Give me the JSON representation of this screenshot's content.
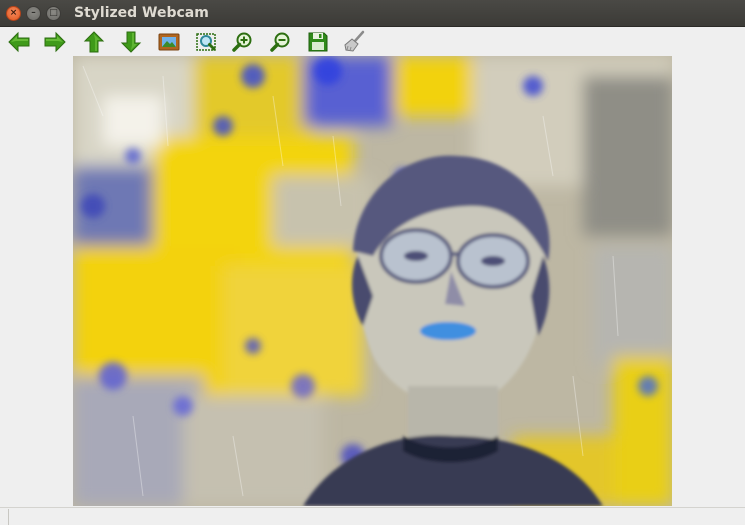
{
  "window": {
    "title": "Stylized Webcam",
    "close_glyph": "×",
    "minimize_glyph": "–",
    "maximize_glyph": "□"
  },
  "toolbar": {
    "items": [
      {
        "name": "back-button",
        "icon": "arrow-left-icon",
        "tooltip": ""
      },
      {
        "name": "forward-button",
        "icon": "arrow-right-icon",
        "tooltip": ""
      },
      {
        "name": "up-button",
        "icon": "arrow-up-icon",
        "tooltip": ""
      },
      {
        "name": "down-button",
        "icon": "arrow-down-icon",
        "tooltip": ""
      },
      {
        "name": "image-button",
        "icon": "picture-icon",
        "tooltip": ""
      },
      {
        "name": "zoom-fit-button",
        "icon": "zoom-fit-icon",
        "tooltip": ""
      },
      {
        "name": "zoom-in-button",
        "icon": "zoom-in-icon",
        "tooltip": ""
      },
      {
        "name": "zoom-out-button",
        "icon": "zoom-out-icon",
        "tooltip": ""
      },
      {
        "name": "save-button",
        "icon": "floppy-disk-icon",
        "tooltip": ""
      },
      {
        "name": "clear-button",
        "icon": "broom-icon",
        "tooltip": ""
      }
    ]
  },
  "colors": {
    "arrow_green": "#3f9a1a",
    "titlebar": "#3c3b37",
    "style_yellow": "#f3d40b",
    "style_blue": "#4a55c8",
    "style_grey": "#c9c6b8"
  },
  "viewer": {
    "content": "stylized-webcam-frame"
  },
  "status": {
    "text": ""
  }
}
